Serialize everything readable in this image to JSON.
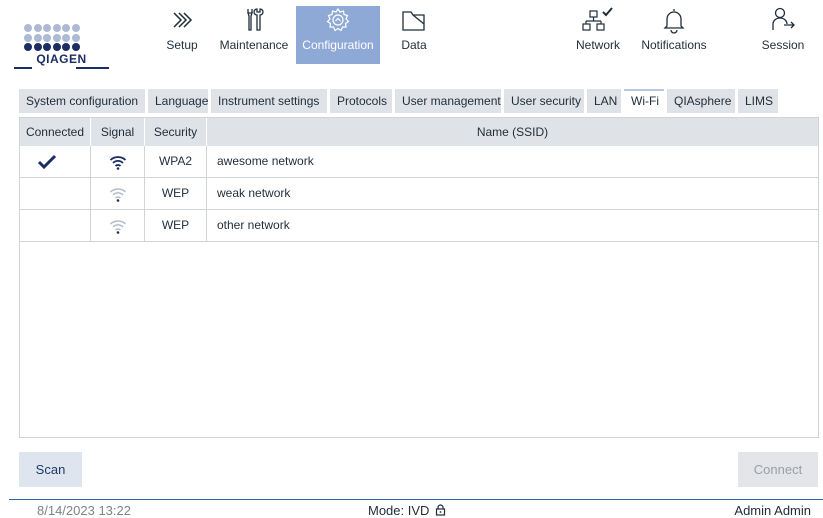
{
  "brand": {
    "logo_text": "QIAGEN",
    "color": "#1b2d63"
  },
  "nav": {
    "setup": "Setup",
    "maintenance": "Maintenance",
    "configuration": "Configuration",
    "data": "Data",
    "network": "Network",
    "notifications": "Notifications",
    "session": "Session",
    "active": "Configuration",
    "active_color": "#8fa9d6"
  },
  "tabs": [
    {
      "label": "System configuration"
    },
    {
      "label": "Language"
    },
    {
      "label": "Instrument settings"
    },
    {
      "label": "Protocols"
    },
    {
      "label": "User management"
    },
    {
      "label": "User security"
    },
    {
      "label": "LAN"
    },
    {
      "label": "Wi-Fi",
      "active": true
    },
    {
      "label": "QIAsphere"
    },
    {
      "label": "LIMS"
    }
  ],
  "table": {
    "headers": {
      "connected": "Connected",
      "signal": "Signal",
      "security": "Security",
      "name": "Name (SSID)"
    },
    "rows": [
      {
        "connected": true,
        "signal": "strong",
        "security": "WPA2",
        "name": "awesome network"
      },
      {
        "connected": false,
        "signal": "weak",
        "security": "WEP",
        "name": "weak network"
      },
      {
        "connected": false,
        "signal": "weak",
        "security": "WEP",
        "name": "other network"
      }
    ]
  },
  "buttons": {
    "scan": "Scan",
    "connect": "Connect",
    "connect_enabled": false
  },
  "footer": {
    "datetime": "8/14/2023 13:22",
    "mode": "Mode: IVD",
    "user": "Admin Admin"
  }
}
